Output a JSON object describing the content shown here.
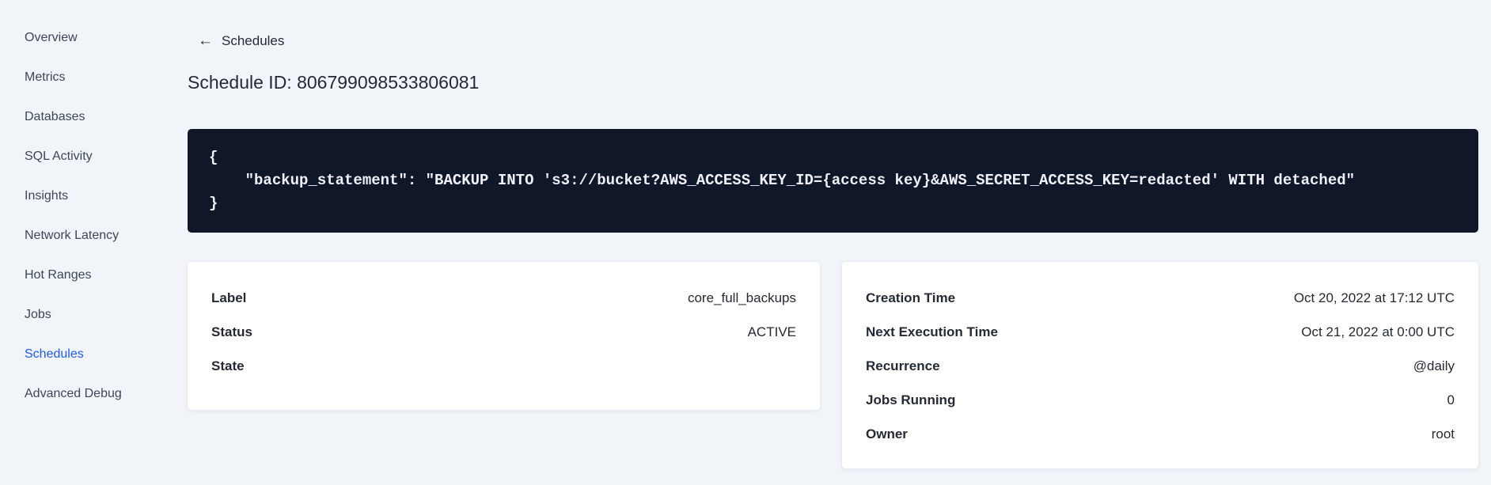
{
  "sidebar": {
    "items": [
      {
        "label": "Overview",
        "active": false
      },
      {
        "label": "Metrics",
        "active": false
      },
      {
        "label": "Databases",
        "active": false
      },
      {
        "label": "SQL Activity",
        "active": false
      },
      {
        "label": "Insights",
        "active": false
      },
      {
        "label": "Network Latency",
        "active": false
      },
      {
        "label": "Hot Ranges",
        "active": false
      },
      {
        "label": "Jobs",
        "active": false
      },
      {
        "label": "Schedules",
        "active": true
      },
      {
        "label": "Advanced Debug",
        "active": false
      }
    ]
  },
  "header": {
    "back_icon": "←",
    "back_label": "Schedules",
    "title": "Schedule ID: 806799098533806081"
  },
  "code_block": {
    "text": "{\n    \"backup_statement\": \"BACKUP INTO 's3://bucket?AWS_ACCESS_KEY_ID={access key}&AWS_SECRET_ACCESS_KEY=redacted' WITH detached\"\n}"
  },
  "details_card": {
    "rows": [
      {
        "label": "Label",
        "value": "core_full_backups"
      },
      {
        "label": "Status",
        "value": "ACTIVE"
      },
      {
        "label": "State",
        "value": ""
      }
    ]
  },
  "schedule_card": {
    "rows": [
      {
        "label": "Creation Time",
        "value": "Oct 20, 2022 at 17:12 UTC"
      },
      {
        "label": "Next Execution Time",
        "value": "Oct 21, 2022 at 0:00 UTC"
      },
      {
        "label": "Recurrence",
        "value": "@daily"
      },
      {
        "label": "Jobs Running",
        "value": "0"
      },
      {
        "label": "Owner",
        "value": "root"
      }
    ]
  },
  "colors": {
    "page_background": "#f1f5f9",
    "active_link_blue": "#1d5af2",
    "text_dark": "#242a35",
    "sidebar_text": "#3d4754",
    "code_background": "#0f1729",
    "code_text": "#eef1f6",
    "card_background": "#ffffff"
  }
}
